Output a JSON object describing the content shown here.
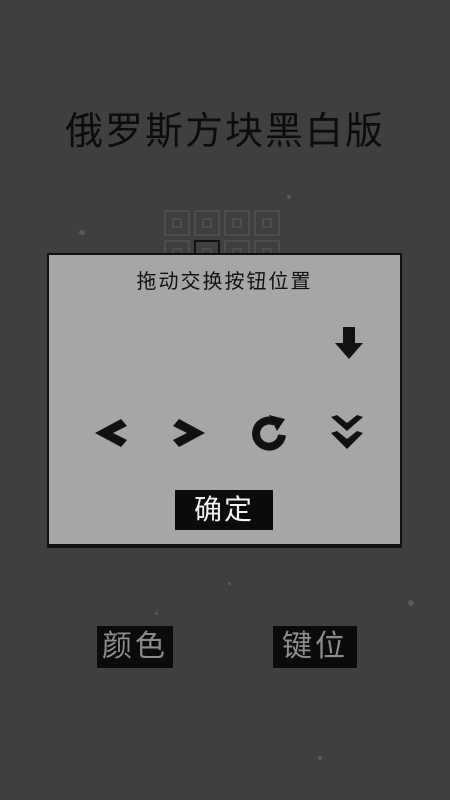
{
  "title": "俄罗斯方块黑白版",
  "dialog": {
    "title": "拖动交换按钮位置",
    "confirm_label": "确定"
  },
  "bottom_buttons": {
    "color_label": "颜色",
    "keys_label": "键位"
  },
  "icons": [
    "arrow-down-icon",
    "arrow-left-icon",
    "arrow-right-icon",
    "rotate-icon",
    "double-chevron-down-icon"
  ],
  "colors": {
    "background": "#3f3f3f",
    "dialog": "#a6a6a6",
    "button": "#0b0b0b"
  }
}
